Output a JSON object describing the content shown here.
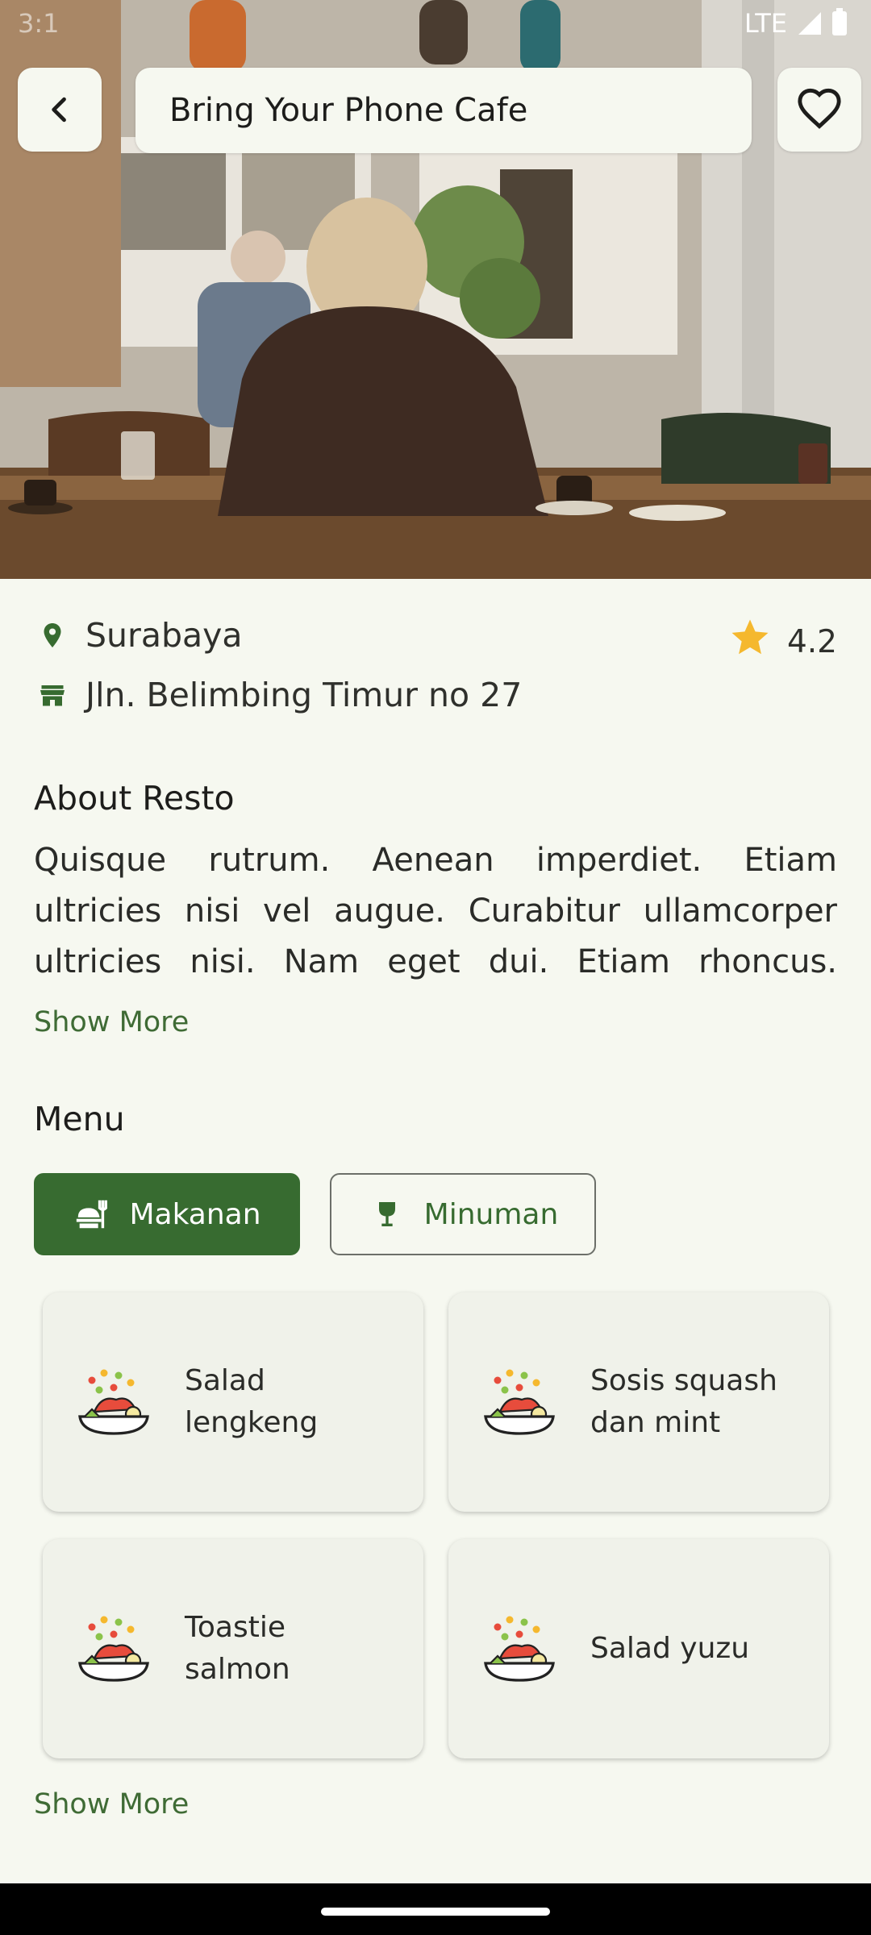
{
  "status_bar": {
    "time": "3:1",
    "network": "LTE"
  },
  "header": {
    "title": "Bring Your Phone Cafe"
  },
  "icons": {
    "back": "chevron-left-icon",
    "favorite": "heart-outline-icon",
    "location": "map-pin-icon",
    "address": "store-icon",
    "rating": "star-icon",
    "food_tab": "food-icon",
    "drink_tab": "glass-icon",
    "menu_item": "salad-bowl-icon"
  },
  "restaurant": {
    "city": "Surabaya",
    "address": "Jln. Belimbing Timur no 27",
    "rating": "4.2"
  },
  "about": {
    "title": "About Resto",
    "description": "Quisque rutrum. Aenean imperdiet. Etiam ultricies nisi vel augue. Curabitur ullamcorper ultricies nisi. Nam eget dui. Etiam rhoncus. Mae…",
    "show_more": "Show More"
  },
  "menu": {
    "title": "Menu",
    "tabs": [
      {
        "label": "Makanan",
        "active": true
      },
      {
        "label": "Minuman",
        "active": false
      }
    ],
    "items": [
      {
        "name": "Salad lengkeng"
      },
      {
        "name": "Sosis squash dan mint"
      },
      {
        "name": "Toastie salmon"
      },
      {
        "name": "Salad yuzu"
      }
    ],
    "show_more": "Show More"
  },
  "colors": {
    "background": "#f6f8f0",
    "primary": "#376b30",
    "star": "#f5b82e",
    "card": "#f0f2ea"
  }
}
